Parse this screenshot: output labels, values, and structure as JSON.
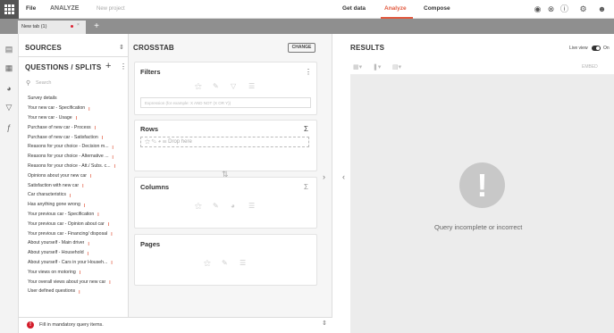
{
  "topbar": {
    "file": "File",
    "analyze": "ANALYZE",
    "new_project": "New project",
    "get_data": "Get data",
    "analyze_nav": "Analyze",
    "compose": "Compose",
    "accent": "#e2593e"
  },
  "tabs": {
    "tab1": "New tab (1)",
    "tab1_close": "×",
    "add": "+"
  },
  "sources": {
    "title": "SOURCES"
  },
  "questions": {
    "title": "QUESTIONS / SPLITS",
    "search_placeholder": "Search",
    "items": [
      "Survey details",
      "Your new car - Specification",
      "Your new car - Usage",
      "Purchase of new car - Process",
      "Purchase of new car - Satisfaction",
      "Reasons for your choice - Decision m...",
      "Reasons for your choice - Alternative ...",
      "Reasons for your choice - Att./ Subs. c...",
      "Opinions about your new car",
      "Satisfaction with new car",
      "Car characteristics",
      "Has anything gone wrong",
      "Your previous car - Specification",
      "Your previous car - Opinion about car",
      "Your previous car - Financing/ disposal",
      "About yourself - Main driver",
      "About yourself - Household",
      "About yourself - Cars in your Househ...",
      "Your views on motoring",
      "Your overall views about your new car",
      "User defined questions"
    ]
  },
  "crosstab": {
    "title": "CROSSTAB",
    "change_label": "CHANGE",
    "filters": "Filters",
    "filter_placeholder": "Expression (for example: X AND NOT (X OR Y))",
    "rows": "Rows",
    "drop_here": "Drop here",
    "columns": "Columns",
    "pages": "Pages"
  },
  "results": {
    "title": "RESULTS",
    "live_view": "Live view",
    "live_state": "On",
    "embed": "EMBED",
    "message": "Query incomplete or incorrect"
  },
  "status": {
    "message": "Fill in mandatory query items."
  }
}
